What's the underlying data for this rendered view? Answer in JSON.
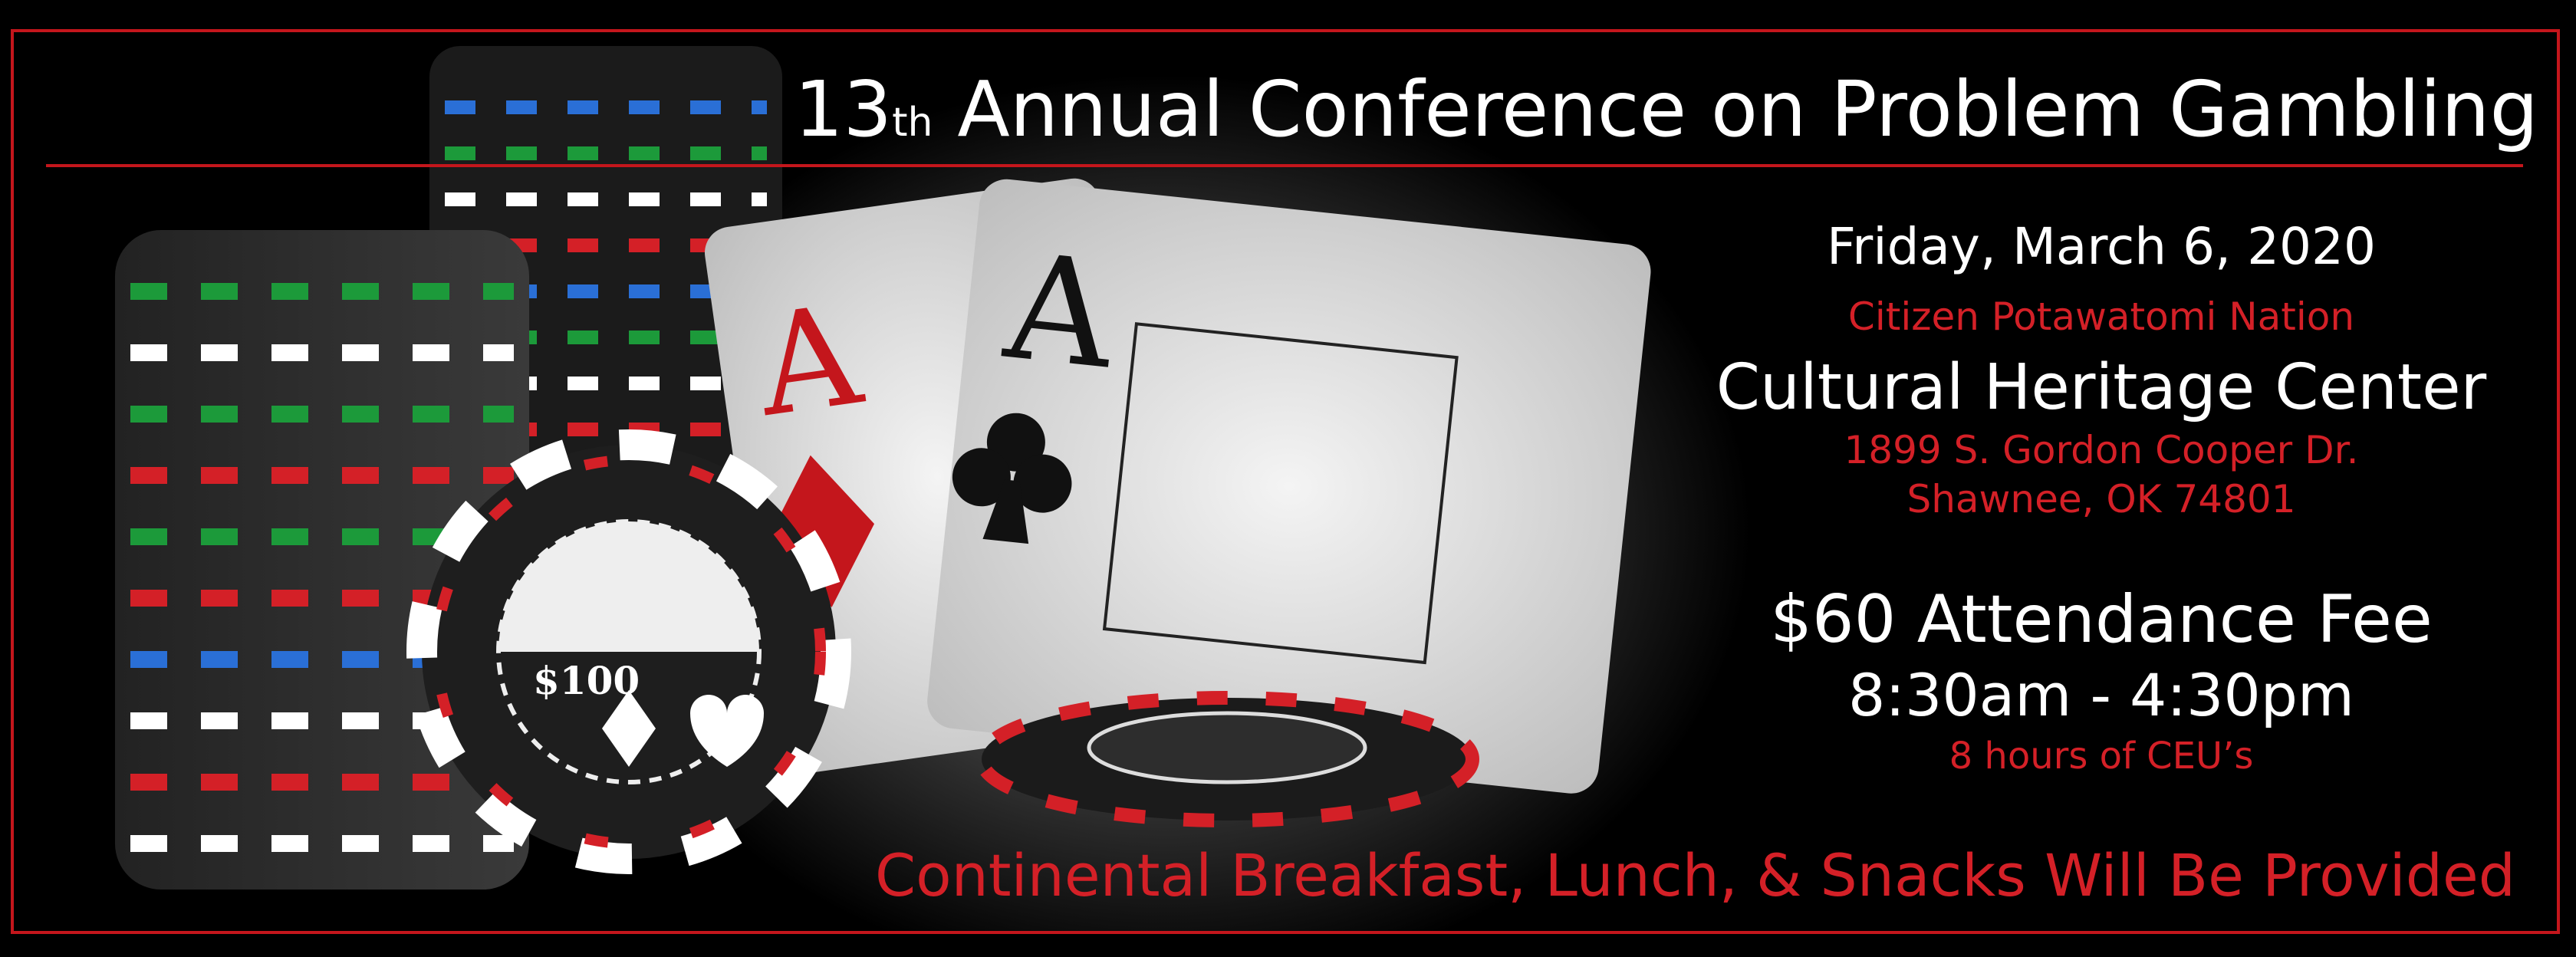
{
  "header": {
    "title_number": "13",
    "title_suffix": "th",
    "title_rest": " Annual Conference on Problem Gambling"
  },
  "event": {
    "date": "Friday, March 6, 2020",
    "host": "Citizen Potawatomi Nation",
    "venue": "Cultural Heritage Center",
    "address_line1": "1899 S. Gordon Cooper Dr.",
    "address_line2": "Shawnee, OK 74801",
    "fee": "$60 Attendance Fee",
    "time": "8:30am - 4:30pm",
    "ceu": "8 hours of CEU’s"
  },
  "footer": {
    "meals": "Continental Breakfast, Lunch, & Snacks Will Be Provided"
  },
  "artwork": {
    "card1_rank": "A",
    "card2_rank": "A",
    "chip_value": "$100"
  },
  "colors": {
    "accent_red": "#c4161c",
    "background": "#000000"
  }
}
